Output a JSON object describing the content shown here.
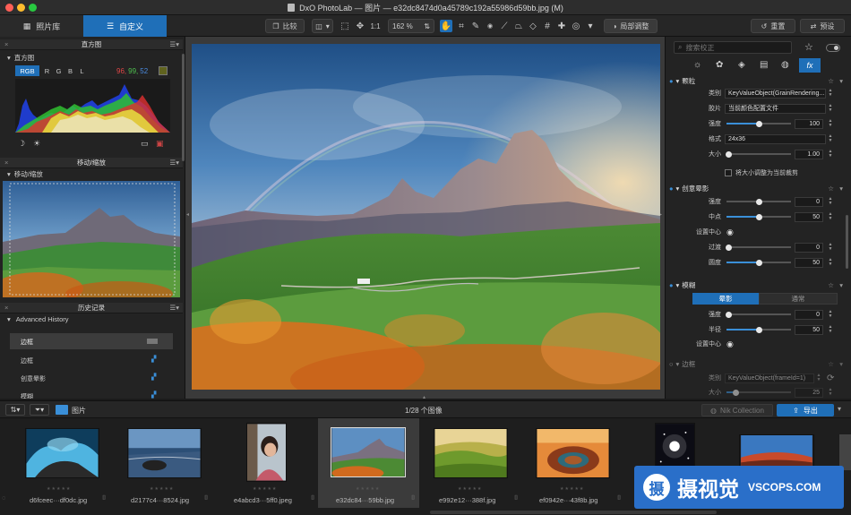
{
  "window": {
    "title": "DxO PhotoLab — 图片 — e32dc8474d0a45789c192a55986d59bb.jpg (M)"
  },
  "toolbar": {
    "tab_library": "照片库",
    "tab_customize": "自定义",
    "compare_label": "比较",
    "one_to_one": "1:1",
    "zoom": "162 %",
    "local_adjust_label": "局部调整",
    "reset_label": "重置",
    "preset_label": "预设"
  },
  "left": {
    "histogram_panel_title": "直方图",
    "histogram_sub": "直方图",
    "channels": [
      "RGB",
      "R",
      "G",
      "B",
      "L"
    ],
    "rgb_values": [
      "96,",
      "99,",
      "52"
    ],
    "move_zoom_panel_title": "移动/缩放",
    "move_zoom_sub": "移动/缩放",
    "history_panel_title": "历史记录",
    "history_sub": "Advanced History",
    "history_items": [
      "边框",
      "边框",
      "创意晕影",
      "模糊"
    ]
  },
  "right": {
    "search_placeholder": "搜索校正",
    "grain": {
      "title": "颗粒",
      "type_label": "类别",
      "type_value": "KeyValueObject(GrainRendering...",
      "film_label": "胶片",
      "film_value": "当前颜色配置文件",
      "intensity_label": "强度",
      "intensity_value": "100",
      "format_label": "格式",
      "format_value": "24x36",
      "size_label": "大小",
      "size_value": "1.00",
      "checkbox_label": "将大小调整为当前裁剪"
    },
    "vignette": {
      "title": "创意晕影",
      "intensity_label": "强度",
      "intensity_value": "0",
      "midpoint_label": "中点",
      "midpoint_value": "50",
      "center_label": "设置中心",
      "transition_label": "过渡",
      "transition_value": "0",
      "roundness_label": "圆度",
      "roundness_value": "50"
    },
    "blur": {
      "title": "模糊",
      "tab_vignette": "晕影",
      "tab_uniform": "通常",
      "intensity_label": "强度",
      "intensity_value": "0",
      "radius_label": "半径",
      "radius_value": "50",
      "center_label": "设置中心"
    },
    "frame": {
      "title": "边框",
      "type_label": "类别",
      "type_value": "KeyValueObject(frameId=1)",
      "size_label": "大小",
      "size_value": "25"
    }
  },
  "filmbar": {
    "folder_label": "图片",
    "count_label": "1/28 个图像",
    "nik_label": "Nik Collection",
    "export_label": "导出"
  },
  "filmstrip": {
    "items": [
      {
        "name": "d6fceec···df0dc.jpg"
      },
      {
        "name": "d2177c4···8524.jpg"
      },
      {
        "name": "e4abcd3···5ff0.jpeg"
      },
      {
        "name": "e32dc84···59bb.jpg"
      },
      {
        "name": "e992e12···388f.jpg"
      },
      {
        "name": "ef0942e···43f8b.jpg"
      },
      {
        "name": ""
      },
      {
        "name": ""
      }
    ],
    "stars": "★★★★★"
  },
  "watermark": {
    "brand_cn": "摄视觉",
    "brand_en": "VSCOPS.COM"
  },
  "colors": {
    "accent": "#1f6fb8",
    "rgb_swatch": "#60631f"
  }
}
